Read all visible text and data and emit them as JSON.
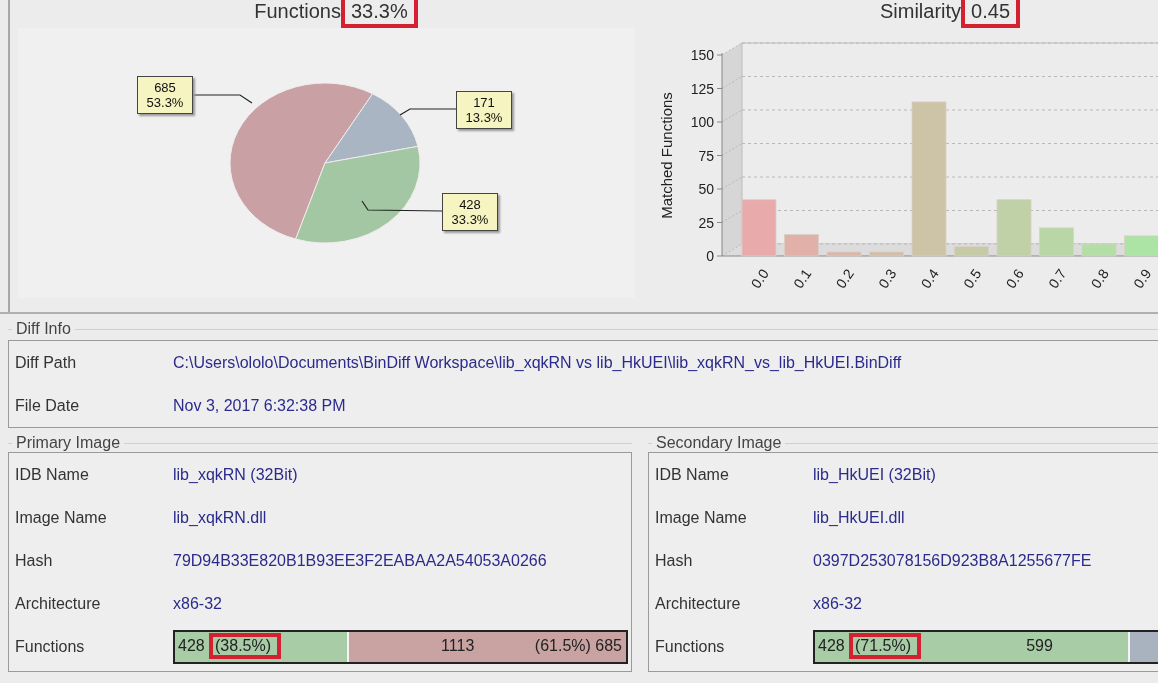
{
  "functions_chart": {
    "title": {
      "label": "Functions",
      "value": "33.3%",
      "highlighted": true
    },
    "chart_data": {
      "type": "pie",
      "values": [
        685,
        171,
        428
      ],
      "colors": [
        "#c9a1a4",
        "#a9b5c3",
        "#a3c7a3"
      ],
      "value_labels": [
        "685\n53.3%",
        "171\n13.3%",
        "428\n33.3%"
      ]
    }
  },
  "similarity_chart": {
    "title": {
      "label": "Similarity",
      "value": "0.45",
      "highlighted": true
    },
    "chart_data": {
      "type": "bar",
      "ylabel": "Matched Functions",
      "categories": [
        "0.0",
        "0.1",
        "0.2",
        "0.3",
        "0.4",
        "0.5",
        "0.6",
        "0.7",
        "0.8",
        "0.9"
      ],
      "values": [
        42,
        16,
        3,
        3,
        115,
        7,
        42,
        21,
        9,
        15
      ],
      "ylim": [
        0,
        150
      ],
      "yticks": [
        0,
        25,
        50,
        75,
        100,
        125,
        150
      ]
    }
  },
  "diff_info": {
    "title": "Diff Info",
    "rows": [
      {
        "label": "Diff Path",
        "value": "C:\\Users\\ololo\\Documents\\BinDiff Workspace\\lib_xqkRN vs lib_HkUEI\\lib_xqkRN_vs_lib_HkUEI.BinDiff"
      },
      {
        "label": "File Date",
        "value": "Nov 3, 2017 6:32:38 PM"
      }
    ]
  },
  "images": [
    {
      "title": "Primary Image",
      "rows": [
        {
          "label": "IDB Name",
          "value": "lib_xqkRN (32Bit)"
        },
        {
          "label": "Image Name",
          "value": "lib_xqkRN.dll"
        },
        {
          "label": "Hash",
          "value": "79D94B33E820B1B93EE3F2EABAA2A54053A0266"
        },
        {
          "label": "Architecture",
          "value": "x86-32"
        }
      ],
      "functions": {
        "label": "Functions",
        "count": "428",
        "percent": "(38.5%)",
        "highlighted": true,
        "level": 0.385,
        "total": "1113",
        "rest": {
          "text": "(61.5%) 685",
          "color": "#c9a3a1"
        }
      }
    },
    {
      "title": "Secondary Image",
      "rows": [
        {
          "label": "IDB Name",
          "value": "lib_HkUEI (32Bit)"
        },
        {
          "label": "Image Name",
          "value": "lib_HkUEI.dll"
        },
        {
          "label": "Hash",
          "value": "0397D253078156D923B8A1255677FE"
        },
        {
          "label": "Architecture",
          "value": "x86-32"
        }
      ],
      "functions": {
        "label": "Functions",
        "count": "428",
        "percent": "(71.5%)",
        "highlighted": true,
        "level": 0.715,
        "total": "599",
        "rest": {
          "color": "#a9b3bf"
        }
      }
    }
  ]
}
